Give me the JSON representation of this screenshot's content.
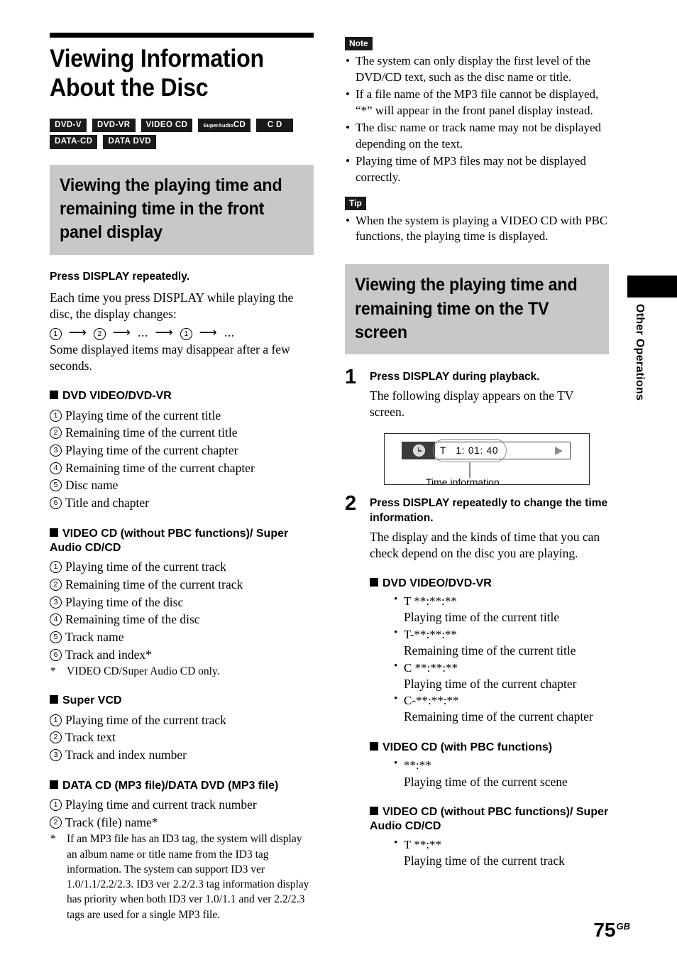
{
  "page": {
    "title": "Viewing Information About the Disc",
    "number": "75",
    "number_suffix": "GB",
    "side_tab_label": "Other Operations"
  },
  "disc_badges": {
    "row1": [
      {
        "label": "DVD-V"
      },
      {
        "label": "DVD-VR"
      },
      {
        "label": "VIDEO CD"
      },
      {
        "label": "Super Audio CD",
        "style": "super-audio"
      },
      {
        "label": "C D"
      }
    ],
    "row2": [
      {
        "label": "DATA-CD"
      },
      {
        "label": "DATA DVD"
      }
    ]
  },
  "section_front_panel": {
    "heading": "Viewing the playing time and remaining time in the front panel display",
    "instruction": "Press DISPLAY repeatedly.",
    "intro": "Each time you press DISPLAY while playing the disc, the display changes:",
    "sequence": [
      "1",
      "2",
      "...",
      "1",
      "..."
    ],
    "note_after_sequence": "Some displayed items may disappear after a few seconds.",
    "groups": [
      {
        "heading": "DVD VIDEO/DVD-VR",
        "items": [
          "Playing time of the current title",
          "Remaining time of the current title",
          "Playing time of the current chapter",
          "Remaining time of the current chapter",
          "Disc name",
          "Title and chapter"
        ]
      },
      {
        "heading": "VIDEO CD (without PBC functions)/ Super Audio CD/CD",
        "items": [
          "Playing time of the current track",
          "Remaining time of the current track",
          "Playing time of the disc",
          "Remaining time of the disc",
          "Track name",
          "Track and index*"
        ],
        "footnote": "VIDEO CD/Super Audio CD only."
      },
      {
        "heading": "Super VCD",
        "items": [
          "Playing time of the current track",
          "Track text",
          "Track and index number"
        ]
      },
      {
        "heading": "DATA CD (MP3 file)/DATA DVD (MP3 file)",
        "items": [
          "Playing time and current track number",
          "Track (file) name*"
        ],
        "footnote": "If an MP3 file has an ID3 tag, the system will display an album name or title name from the ID3 tag information.\nThe system can support ID3 ver 1.0/1.1/2.2/2.3. ID3 ver 2.2/2.3 tag information display has priority when both ID3 ver 1.0/1.1 and ver 2.2/2.3 tags are used for a single MP3 file."
      }
    ]
  },
  "note_block": {
    "tag": "Note",
    "items": [
      "The system can only display the first level of the DVD/CD text, such as the disc name or title.",
      "If a file name of the MP3 file cannot be displayed, “*” will appear in the front panel display instead.",
      "The disc name or track name may not be displayed depending on the text.",
      "Playing time of MP3 files may not be displayed correctly."
    ]
  },
  "tip_block": {
    "tag": "Tip",
    "items": [
      "When the system is playing a VIDEO CD with PBC functions, the playing time is displayed."
    ]
  },
  "section_tv_screen": {
    "heading": "Viewing the playing time and remaining time on the TV screen",
    "steps": [
      {
        "number": "1",
        "heading": "Press DISPLAY during playback.",
        "body": "The following display appears on the TV screen."
      },
      {
        "number": "2",
        "heading": "Press DISPLAY repeatedly to change the time information.",
        "body": "The display and the kinds of time that you can check depend on the disc you are playing."
      }
    ],
    "figure": {
      "time_value": "T   1: 01: 40",
      "caption": "Time information",
      "clock_icon": "clock-icon",
      "play_icon": "play-triangle-icon"
    },
    "groups": [
      {
        "heading": "DVD VIDEO/DVD-VR",
        "entries": [
          {
            "code": "T **:**:**",
            "desc": "Playing time of the current title"
          },
          {
            "code": "T-**:**:**",
            "desc": "Remaining time of the current title"
          },
          {
            "code": "C **:**:**",
            "desc": "Playing time of the current chapter"
          },
          {
            "code": "C-**:**:**",
            "desc": "Remaining time of the current chapter"
          }
        ]
      },
      {
        "heading": "VIDEO CD (with PBC functions)",
        "entries": [
          {
            "code": "**:**",
            "desc": "Playing time of the current scene"
          }
        ]
      },
      {
        "heading": "VIDEO CD (without PBC functions)/ Super Audio CD/CD",
        "entries": [
          {
            "code": "T **:**",
            "desc": "Playing time of the current track"
          }
        ]
      }
    ]
  }
}
